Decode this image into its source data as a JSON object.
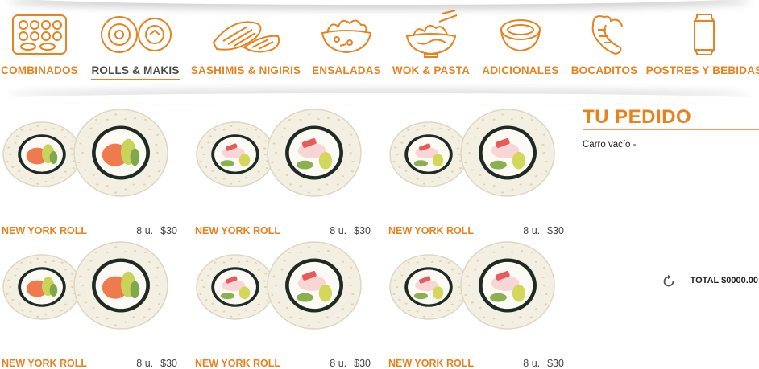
{
  "categories": [
    {
      "label": "COMBINADOS",
      "icon": "sushi-box-icon",
      "active": false
    },
    {
      "label": "ROLLS & MAKIS",
      "icon": "maki-rolls-icon",
      "active": true
    },
    {
      "label": "SASHIMIS & NIGIRIS",
      "icon": "nigiri-icon",
      "active": false
    },
    {
      "label": "ENSALADAS",
      "icon": "salad-bowl-icon",
      "active": false
    },
    {
      "label": "WOK & PASTA",
      "icon": "noodles-bowl-icon",
      "active": false
    },
    {
      "label": "ADICIONALES",
      "icon": "sauce-bowl-icon",
      "active": false
    },
    {
      "label": "BOCADITOS",
      "icon": "shrimp-icon",
      "active": false
    },
    {
      "label": "POSTRES Y BEBIDAS",
      "icon": "drink-can-icon",
      "active": false
    }
  ],
  "products": [
    {
      "name": "NEW YORK ROLL",
      "units": "8 u.",
      "price": "$30",
      "filling": "salmon"
    },
    {
      "name": "NEW YORK ROLL",
      "units": "8 u.",
      "price": "$30",
      "filling": "crab"
    },
    {
      "name": "NEW YORK ROLL",
      "units": "8 u.",
      "price": "$30",
      "filling": "crab"
    },
    {
      "name": "NEW YORK ROLL",
      "units": "8 u.",
      "price": "$30",
      "filling": "salmon"
    },
    {
      "name": "NEW YORK ROLL",
      "units": "8 u.",
      "price": "$30",
      "filling": "crab"
    },
    {
      "name": "NEW YORK ROLL",
      "units": "8 u.",
      "price": "$30",
      "filling": "crab"
    }
  ],
  "order": {
    "title": "TU PEDIDO",
    "empty_text": "Carro vacío -",
    "total": "TOTAL $0000.00",
    "refresh_icon": "refresh-icon"
  },
  "colors": {
    "accent": "#e8821e",
    "text": "#4a4a4a"
  }
}
